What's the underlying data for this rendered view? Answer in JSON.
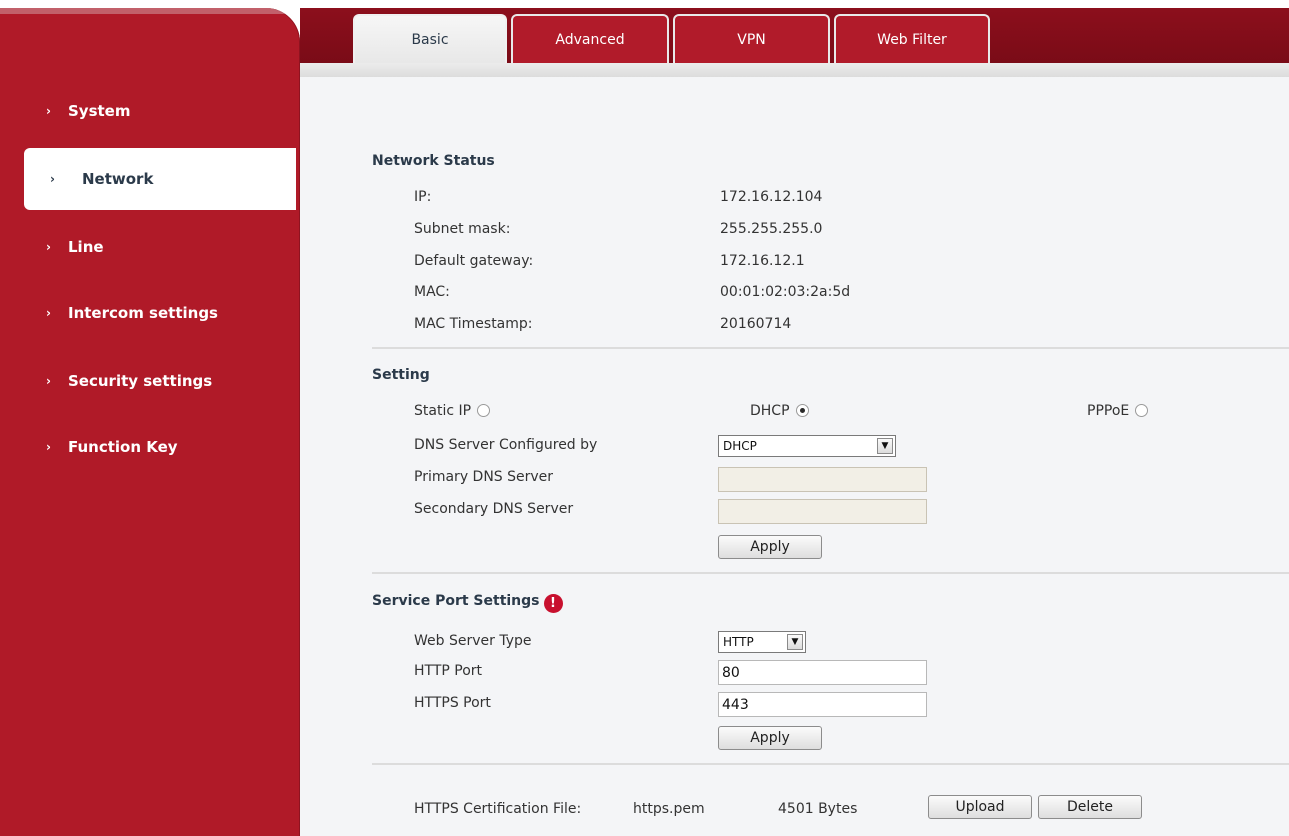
{
  "tabs": [
    {
      "label": "Basic",
      "active": true
    },
    {
      "label": "Advanced",
      "active": false
    },
    {
      "label": "VPN",
      "active": false
    },
    {
      "label": "Web Filter",
      "active": false
    }
  ],
  "sidebar": {
    "items": [
      {
        "label": "System",
        "active": false
      },
      {
        "label": "Network",
        "active": true
      },
      {
        "label": "Line",
        "active": false
      },
      {
        "label": "Intercom settings",
        "active": false
      },
      {
        "label": "Security settings",
        "active": false
      },
      {
        "label": "Function Key",
        "active": false
      }
    ],
    "chevron": "›"
  },
  "network_status": {
    "title": "Network Status",
    "rows": [
      {
        "label": "IP:",
        "value": "172.16.12.104"
      },
      {
        "label": "Subnet mask:",
        "value": "255.255.255.0"
      },
      {
        "label": "Default gateway:",
        "value": "172.16.12.1"
      },
      {
        "label": "MAC:",
        "value": "00:01:02:03:2a:5d"
      },
      {
        "label": "MAC Timestamp:",
        "value": "20160714"
      }
    ]
  },
  "setting": {
    "title": "Setting",
    "mode_options": [
      {
        "label": "Static IP",
        "checked": false
      },
      {
        "label": "DHCP",
        "checked": true
      },
      {
        "label": "PPPoE",
        "checked": false
      }
    ],
    "dns_configured_label": "DNS Server Configured by",
    "dns_configured_value": "DHCP",
    "primary_dns_label": "Primary DNS Server",
    "primary_dns_value": "",
    "secondary_dns_label": "Secondary DNS Server",
    "secondary_dns_value": "",
    "apply_label": "Apply"
  },
  "service_port": {
    "title": "Service Port Settings",
    "help_icon": "!",
    "web_server_type_label": "Web Server Type",
    "web_server_type_value": "HTTP",
    "http_port_label": "HTTP Port",
    "http_port_value": "80",
    "https_port_label": "HTTPS Port",
    "https_port_value": "443",
    "apply_label": "Apply"
  },
  "certificate": {
    "label": "HTTPS Certification File:",
    "filename": "https.pem",
    "size": "4501 Bytes",
    "upload_label": "Upload",
    "delete_label": "Delete"
  },
  "colors": {
    "brand_red": "#b01a28",
    "dark_red": "#7a0b17",
    "content_bg": "#f4f5f7",
    "help_red": "#c8102e"
  }
}
